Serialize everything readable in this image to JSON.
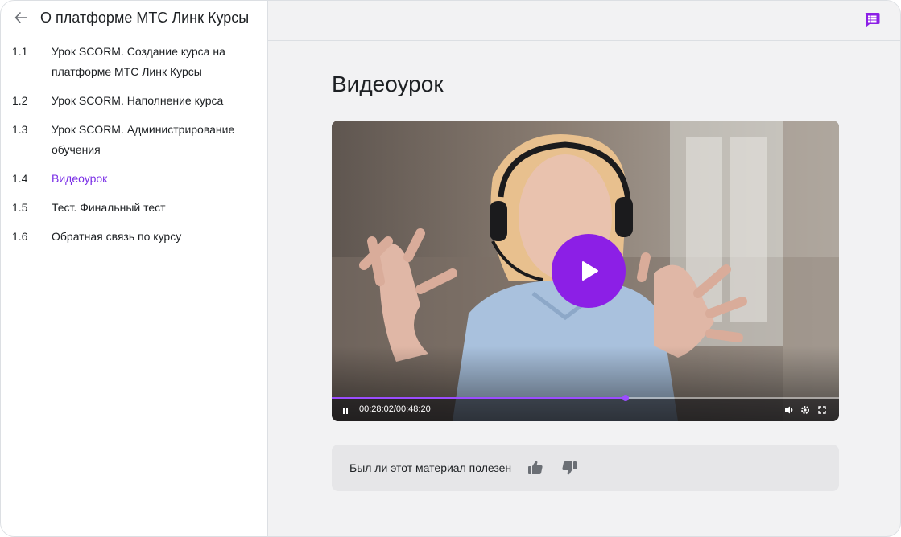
{
  "sidebar": {
    "course_title": "О платформе МТС Линк Курсы",
    "items": [
      {
        "num": "1.1",
        "label": "Урок SCORM. Создание курса на платформе МТС Линк Курсы",
        "active": false
      },
      {
        "num": "1.2",
        "label": "Урок SCORM. Наполнение курса",
        "active": false
      },
      {
        "num": "1.3",
        "label": "Урок SCORM. Администрирование обучения",
        "active": false
      },
      {
        "num": "1.4",
        "label": "Видеоурок",
        "active": true
      },
      {
        "num": "1.5",
        "label": "Тест. Финальный тест",
        "active": false
      },
      {
        "num": "1.6",
        "label": "Обратная связь по курсу",
        "active": false
      }
    ]
  },
  "icons": {
    "back": "arrow-left-icon",
    "chat": "chat-list-icon",
    "play": "play-icon",
    "pause": "pause-icon",
    "volume": "volume-icon",
    "settings": "gear-icon",
    "fullscreen": "fullscreen-icon",
    "like": "thumbs-up-icon",
    "dislike": "thumbs-down-icon"
  },
  "main": {
    "title": "Видеоурок"
  },
  "video": {
    "timecode": "00:28:02/00:48:20",
    "progress": 0.58,
    "state": "paused"
  },
  "feedback": {
    "question": "Был ли этот материал полезен"
  },
  "colors": {
    "accent": "#7a2ee6",
    "play_button": "#8c1fe6"
  }
}
